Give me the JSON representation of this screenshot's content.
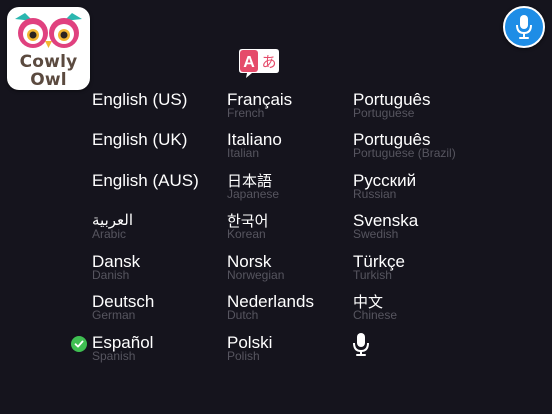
{
  "app": {
    "logo_line1": "Cowly",
    "logo_line2": "Owl",
    "logo_icon": "owl-logo",
    "mic_button_icon": "microphone-icon",
    "header_icon": "translate-icon",
    "header_icon_glyphs": [
      "A",
      "あ"
    ]
  },
  "colors": {
    "background": "#15141d",
    "accent": "#1e8de6",
    "selected": "#3fbf52",
    "native_text": "#ffffff",
    "english_text": "#56555f"
  },
  "selected_language": "Español",
  "languages": [
    {
      "native": "English (US)",
      "english": ""
    },
    {
      "native": "English (UK)",
      "english": ""
    },
    {
      "native": "English (AUS)",
      "english": ""
    },
    {
      "native": "العربية",
      "english": "Arabic"
    },
    {
      "native": "Dansk",
      "english": "Danish"
    },
    {
      "native": "Deutsch",
      "english": "German"
    },
    {
      "native": "Español",
      "english": "Spanish"
    },
    {
      "native": "Français",
      "english": "French"
    },
    {
      "native": "Italiano",
      "english": "Italian"
    },
    {
      "native": "日本語",
      "english": "Japanese"
    },
    {
      "native": "한국어",
      "english": "Korean"
    },
    {
      "native": "Norsk",
      "english": "Norwegian"
    },
    {
      "native": "Nederlands",
      "english": "Dutch"
    },
    {
      "native": "Polski",
      "english": "Polish"
    },
    {
      "native": "Português",
      "english": "Portuguese"
    },
    {
      "native": "Português",
      "english": "Portuguese (Brazil)"
    },
    {
      "native": "Русский",
      "english": "Russian"
    },
    {
      "native": "Svenska",
      "english": "Swedish"
    },
    {
      "native": "Türkçe",
      "english": "Turkish"
    },
    {
      "native": "中文",
      "english": "Chinese"
    }
  ],
  "voice_option_icon": "microphone-icon"
}
